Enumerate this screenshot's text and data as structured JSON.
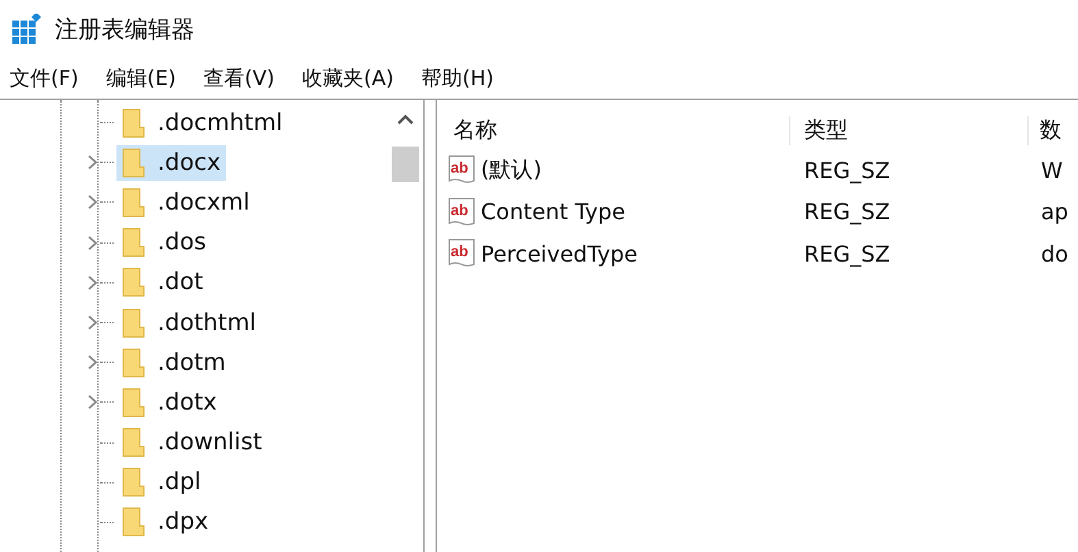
{
  "window": {
    "title": "注册表编辑器"
  },
  "menu": [
    "文件(F)",
    "编辑(E)",
    "查看(V)",
    "收藏夹(A)",
    "帮助(H)"
  ],
  "tree": {
    "items": [
      {
        "label": ".docmhtml",
        "expandable": false,
        "selected": false
      },
      {
        "label": ".docx",
        "expandable": true,
        "selected": true
      },
      {
        "label": ".docxml",
        "expandable": true,
        "selected": false
      },
      {
        "label": ".dos",
        "expandable": true,
        "selected": false
      },
      {
        "label": ".dot",
        "expandable": true,
        "selected": false
      },
      {
        "label": ".dothtml",
        "expandable": true,
        "selected": false
      },
      {
        "label": ".dotm",
        "expandable": true,
        "selected": false
      },
      {
        "label": ".dotx",
        "expandable": true,
        "selected": false
      },
      {
        "label": ".downlist",
        "expandable": false,
        "selected": false
      },
      {
        "label": ".dpl",
        "expandable": false,
        "selected": false
      },
      {
        "label": ".dpx",
        "expandable": false,
        "selected": false
      }
    ]
  },
  "table": {
    "columns": [
      "名称",
      "类型",
      "数"
    ],
    "rows": [
      {
        "icon_label": "ab",
        "name": "(默认)",
        "type": "REG_SZ",
        "data": "W"
      },
      {
        "icon_label": "ab",
        "name": "Content Type",
        "type": "REG_SZ",
        "data": "ap"
      },
      {
        "icon_label": "ab",
        "name": "PerceivedType",
        "type": "REG_SZ",
        "data": "do"
      }
    ]
  }
}
